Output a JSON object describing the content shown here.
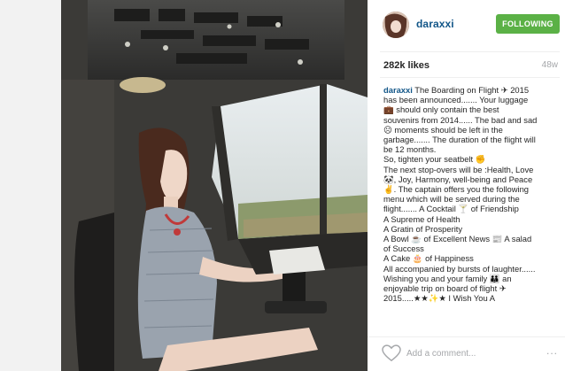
{
  "post": {
    "username": "daraxxi",
    "follow_label": "FOLLOWING",
    "likes": "282k likes",
    "age": "48w",
    "caption_author": "daraxxi",
    "caption_lines": [
      "The Boarding on Flight ✈ 2015",
      "has been announced....... Your luggage",
      "💼 should only contain the best",
      "souvenirs from 2014...... The bad and sad",
      "☹ moments should be left in the",
      "garbage....... The duration of the flight will",
      "be 12 months.",
      "So, tighten your seatbelt ✊",
      "The next stop-overs will be :Health, Love",
      "🐼, Joy, Harmony, well-being and Peace",
      "✌. The captain offers you the following",
      "menu which will be served during the",
      "flight....... A Cocktail 🍸 of Friendship",
      "A Supreme of Health",
      "A Gratin of Prosperity",
      "A Bowl ☕ of Excellent News 📰 A salad",
      "of Success",
      "A Cake 🎂 of Happiness",
      "All accompanied by bursts of laughter......",
      "Wishing you and your family 👪 an",
      "enjoyable trip on board of flight ✈",
      "2015.....★★✨★ I Wish You A"
    ],
    "comment_placeholder": "Add a comment...",
    "more_label": "..."
  },
  "icons": {
    "heart": "heart-icon",
    "avatar": "avatar-photo",
    "photo": "cockpit-photo"
  },
  "colors": {
    "follow_button": "#5bb146",
    "username": "#125688",
    "muted": "#a5a7aa"
  }
}
